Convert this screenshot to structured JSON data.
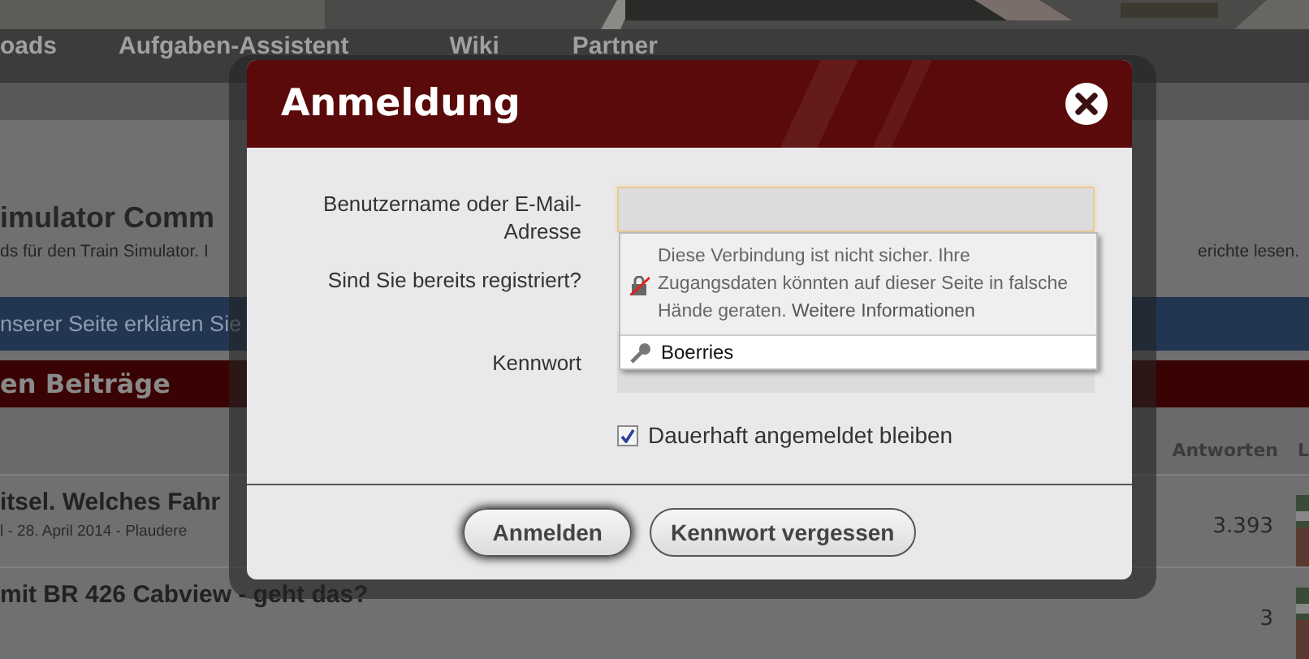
{
  "page": {
    "nav_items": [
      "oads",
      "Aufgaben-Assistent",
      "Wiki",
      "Partner"
    ],
    "title": "imulator Comm",
    "subtitle": "ds für den Train Simulator. I",
    "side_text": "erichte lesen.",
    "notice": "nserer Seite erklären Sie",
    "section_title": "en Beiträge",
    "table": {
      "columns": [
        "Antworten",
        "L"
      ],
      "rows": [
        {
          "title": "itsel. Welches Fahr",
          "meta": "l - 28. April 2014 - Plaudere",
          "replies": "3.393"
        },
        {
          "title": "mit BR 426 Cabview - geht das?",
          "replies": "3"
        }
      ]
    }
  },
  "dialog": {
    "title": "Anmeldung",
    "username_label": "Benutzername oder E-Mail-Adresse",
    "registered_label": "Sind Sie bereits registriert?",
    "password_label": "Kennwort",
    "autofill": {
      "warning": "Diese Verbindung ist nicht sicher. Ihre Zugangsdaten könnten auf dieser Seite in falsche Hände geraten.",
      "link": "Weitere Informationen",
      "suggestions": [
        {
          "label": "Boerries"
        }
      ]
    },
    "remember": {
      "label": "Dauerhaft angemeldet bleiben",
      "checked": true
    },
    "buttons": [
      {
        "label": "Anmelden",
        "focused": true
      },
      {
        "label": "Kennwort vergessen",
        "focused": false
      }
    ]
  }
}
